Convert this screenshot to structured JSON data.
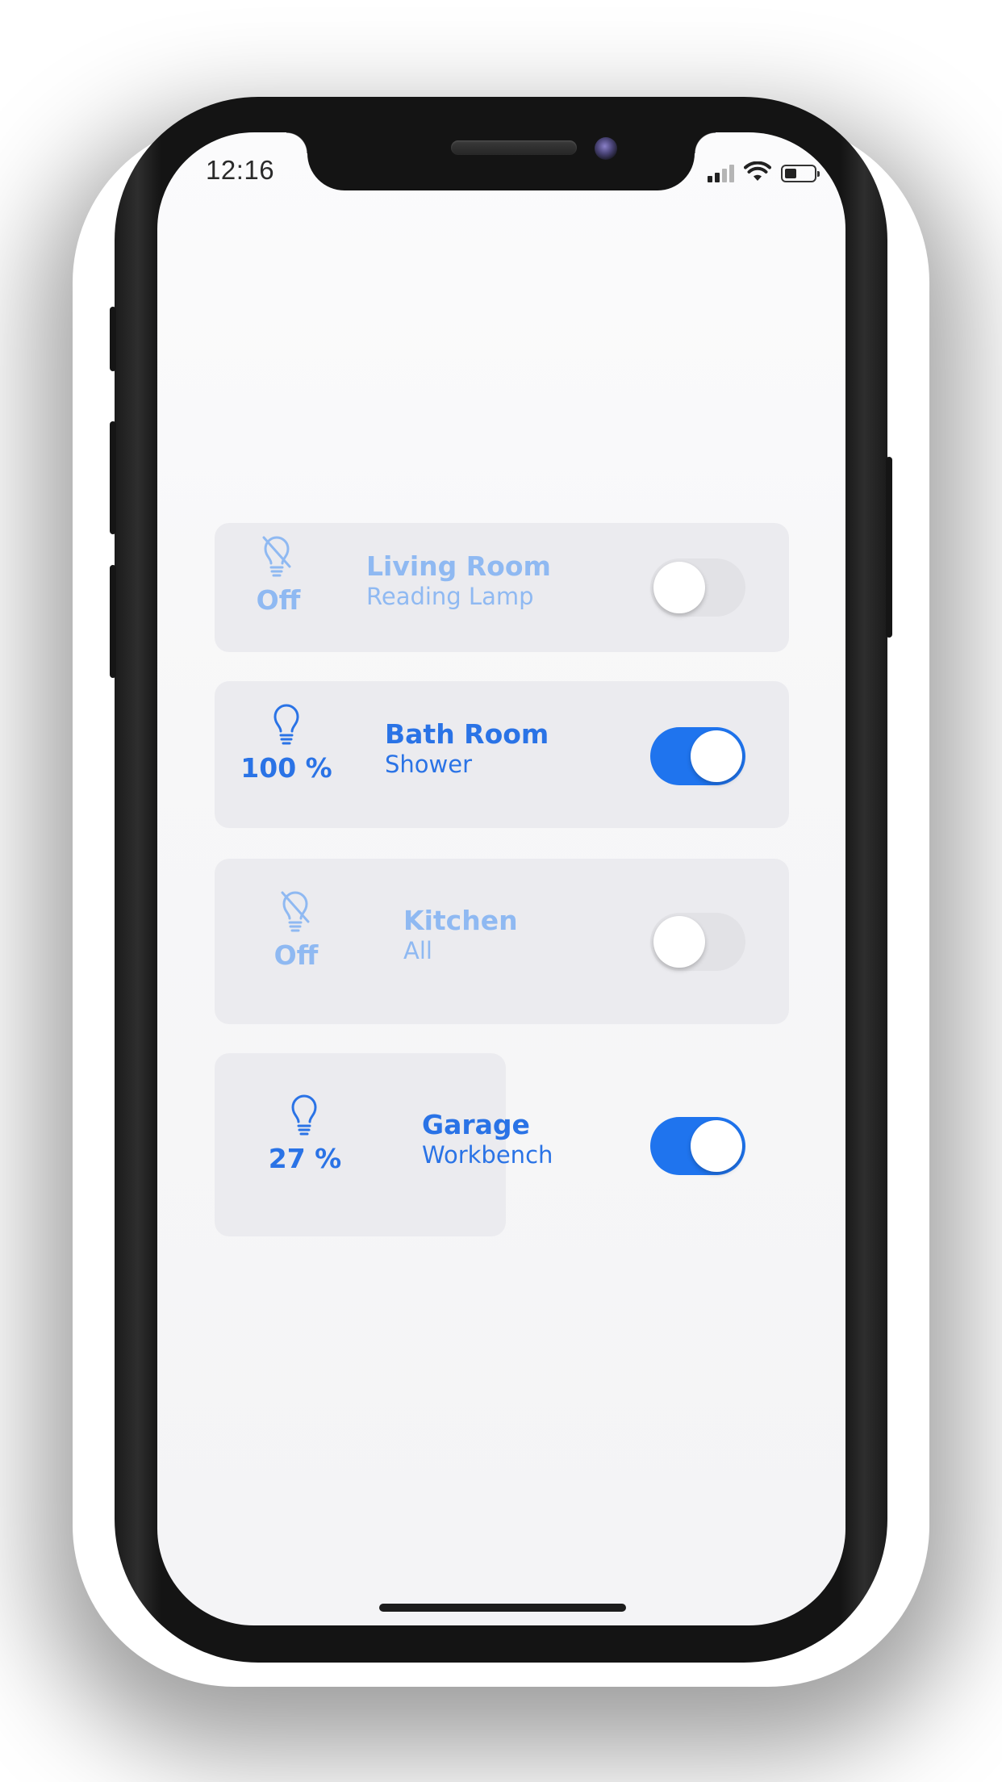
{
  "status_bar": {
    "time": "12:16"
  },
  "lights": [
    {
      "room": "Living Room",
      "fixture": "Reading Lamp",
      "level": "Off",
      "on": false,
      "icon": "lightbulb-off-icon"
    },
    {
      "room": "Bath Room",
      "fixture": "Shower",
      "level": "100 %",
      "on": true,
      "icon": "lightbulb-icon"
    },
    {
      "room": "Kitchen",
      "fixture": "All",
      "level": "Off",
      "on": false,
      "icon": "lightbulb-off-icon"
    },
    {
      "room": "Garage",
      "fixture": "Workbench",
      "level": "27 %",
      "brightness_fraction": 0.27,
      "on": true,
      "icon": "lightbulb-icon"
    }
  ],
  "colors": {
    "accent": "#2a73e6",
    "accent_dim": "#8fb9f2",
    "toggle_on": "#1f74ee",
    "toggle_off": "#e2e2e6",
    "card": "#ebebef"
  }
}
